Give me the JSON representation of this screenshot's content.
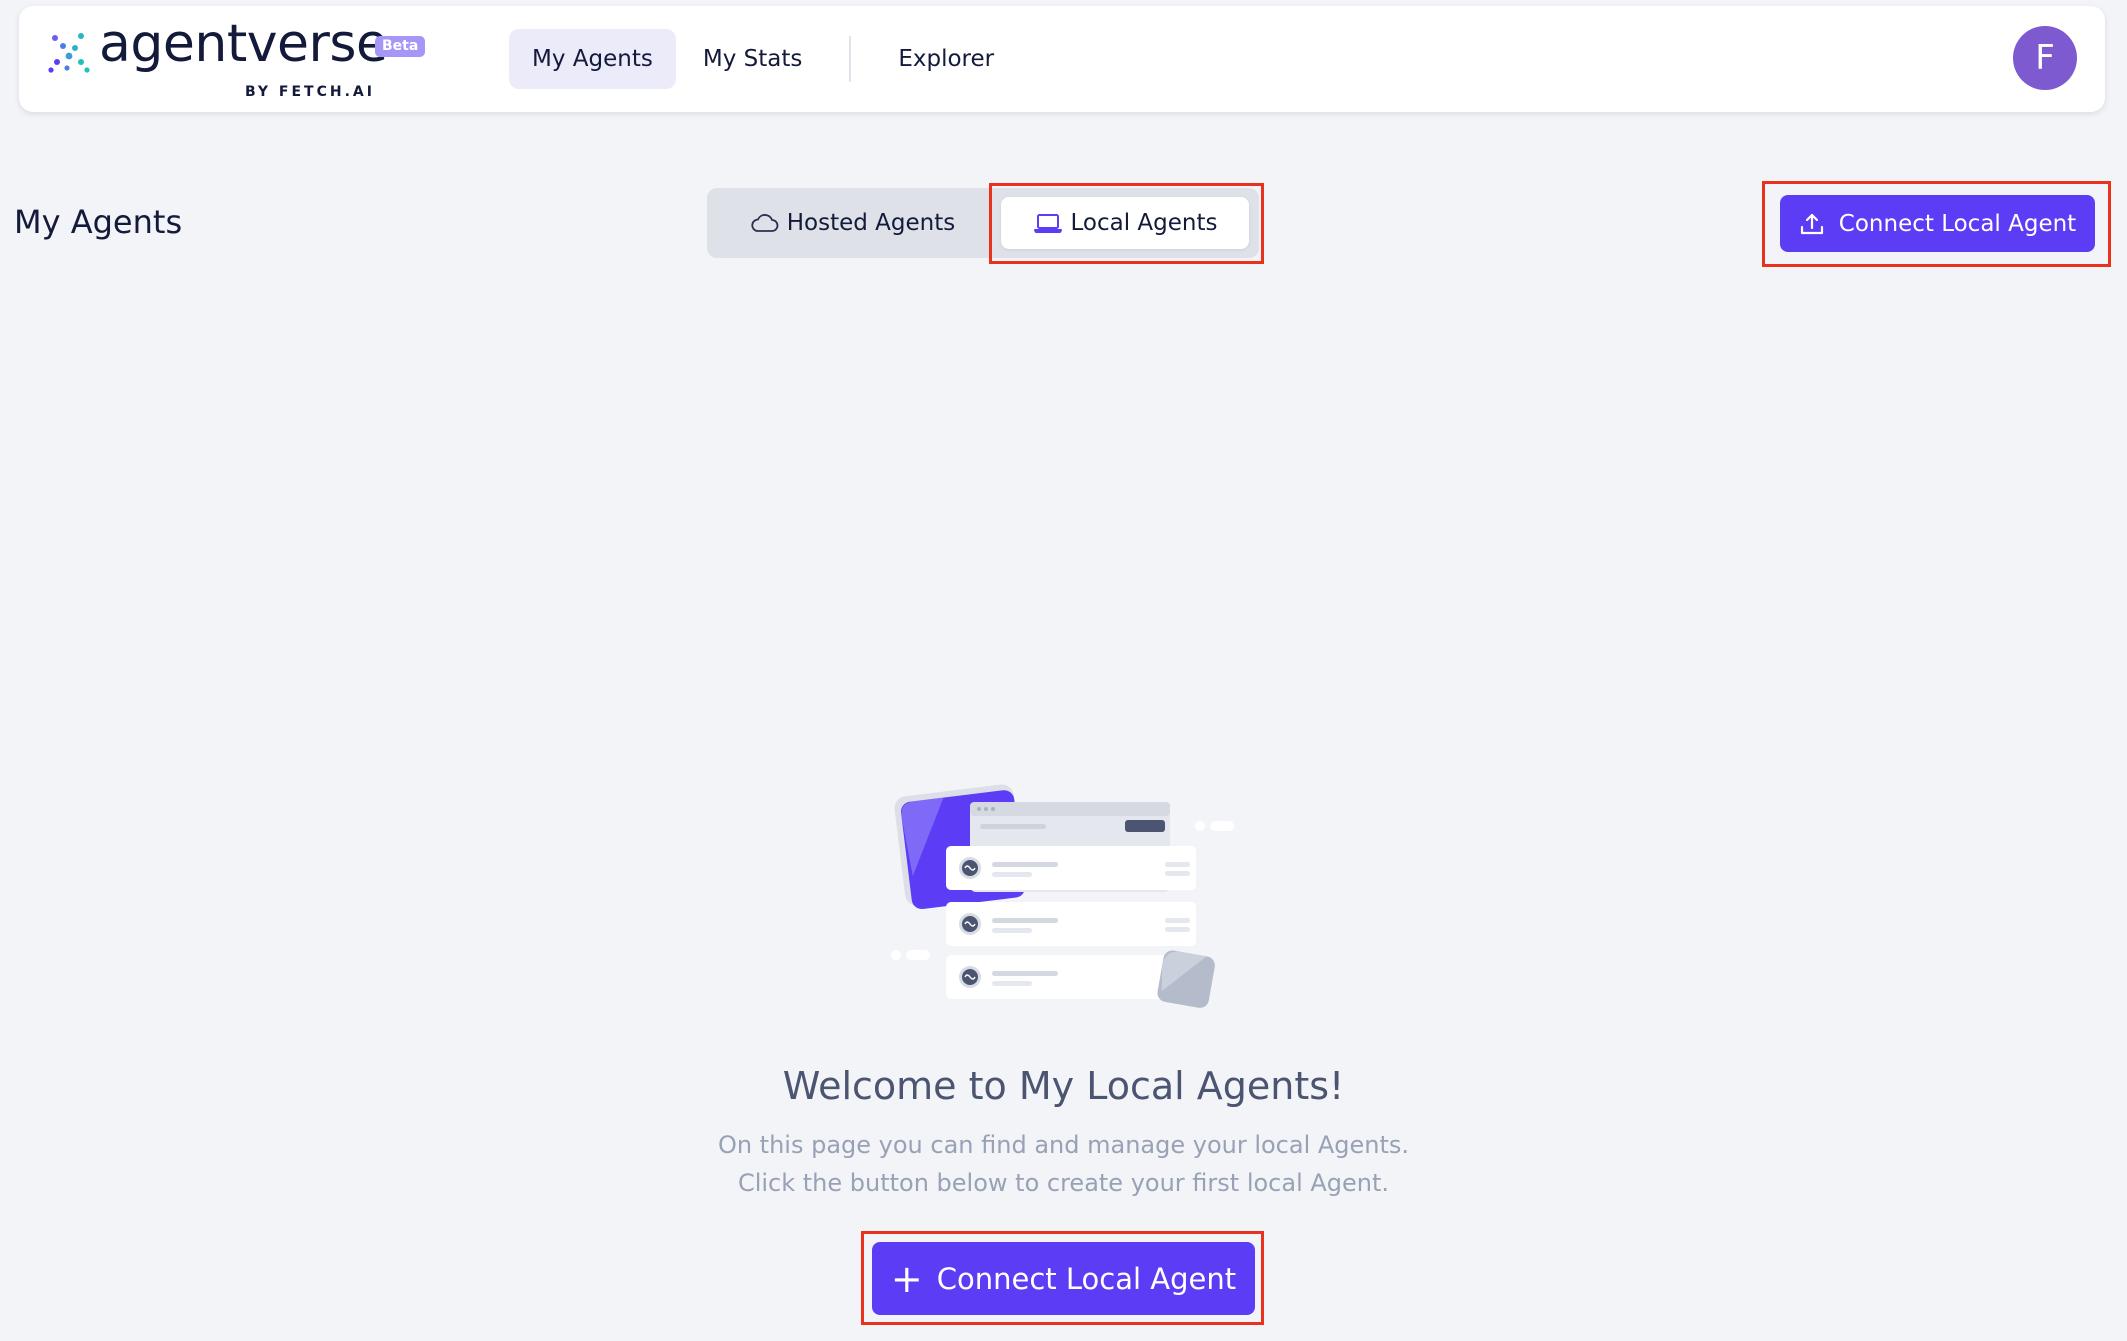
{
  "app": {
    "brand_name": "agentverse",
    "brand_badge": "Beta",
    "brand_byline": "BY FETCH.AI",
    "user_initial": "F"
  },
  "nav": {
    "items": [
      {
        "label": "My Agents",
        "active": true
      },
      {
        "label": "My Stats",
        "active": false
      },
      {
        "label": "Explorer",
        "active": false
      }
    ]
  },
  "page": {
    "title": "My Agents",
    "tabs": [
      {
        "label": "Hosted Agents",
        "icon": "cloud-icon",
        "selected": false
      },
      {
        "label": "Local Agents",
        "icon": "laptop-icon",
        "selected": true
      }
    ],
    "connect_button_label": "Connect Local Agent",
    "connect_button_icon": "upload-icon"
  },
  "empty_state": {
    "title": "Welcome to My Local Agents!",
    "line1": "On this page you can find and manage your local Agents.",
    "line2": "Click the button below to create your first local Agent.",
    "button_label": "Connect Local Agent",
    "button_icon": "plus-icon"
  },
  "colors": {
    "accent": "#5c3df5",
    "background": "#f3f4f8",
    "highlight": "#e8321e",
    "avatar": "#7e5ad1"
  }
}
